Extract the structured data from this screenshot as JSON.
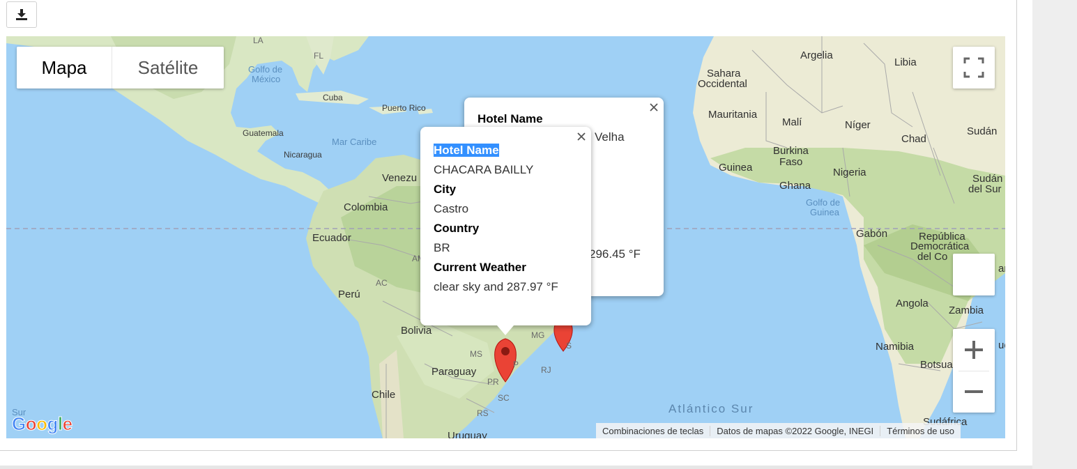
{
  "toolbar": {
    "download_icon": "download-icon"
  },
  "map_type": {
    "map_label": "Mapa",
    "satellite_label": "Satélite"
  },
  "labels": {
    "countries": {
      "argelia": "Argelia",
      "libia": "Libia",
      "sahara": "Sahara",
      "occidental": "Occidental",
      "mauritania": "Mauritania",
      "mali": "Malí",
      "niger": "Níger",
      "chad": "Chad",
      "sudan": "Sudán",
      "burkina": "Burkina",
      "faso": "Faso",
      "guinea": "Guinea",
      "nigeria": "Nigeria",
      "ghana": "Ghana",
      "sudan_sur1": "Sudán",
      "sudan_sur2": "del Sur",
      "gabon": "Gabón",
      "rep1": "República",
      "rep2": "Democrática",
      "rep3": "del Co",
      "rep_ar": "ar",
      "angola": "Angola",
      "zambia": "Zambia",
      "namibia": "Namibia",
      "botsua": "Botsua",
      "ue": "ue",
      "sudafrica": "Sudáfrica",
      "cuba": "Cuba",
      "puerto_rico": "Puerto Rico",
      "guatemala": "Guatemala",
      "nicaragua": "Nicaragua",
      "venezu": "Venezu",
      "colombia": "Colombia",
      "ecuador": "Ecuador",
      "peru": "Perú",
      "bolivia": "Bolivia",
      "paraguay": "Paraguay",
      "chile": "Chile",
      "uruguay": "Uruguay",
      "sur": "Sur"
    },
    "water": {
      "golfo_mexico1": "Golfo de",
      "golfo_mexico2": "México",
      "mar_caribe": "Mar Caribe",
      "golfo_guinea1": "Golfo de",
      "golfo_guinea2": "Guinea",
      "atlantico_sur": "Atlántico Sur"
    },
    "states": {
      "la": "LA",
      "fl": "FL",
      "am": "AM",
      "ac": "AC",
      "mg": "MG",
      "ms": "MS",
      "sp": "P",
      "pr": "PR",
      "rj": "RJ",
      "sc": "SC",
      "rs": "RS",
      "es": "S"
    }
  },
  "info_back": {
    "hotel_name_label": "Hotel Name",
    "hotel_name_partial": "Velha",
    "weather_partial": "296.45 °F"
  },
  "info_front": {
    "hotel_name_label": "Hotel Name",
    "hotel_name": "CHACARA BAILLY",
    "city_label": "City",
    "city": "Castro",
    "country_label": "Country",
    "country": "BR",
    "weather_label": "Current Weather",
    "weather": "clear sky and 287.97 °F"
  },
  "attribution": {
    "shortcuts": "Combinaciones de teclas",
    "data": "Datos de mapas ©2022 Google, INEGI",
    "terms": "Términos de uso"
  },
  "logo": {
    "text": "Google"
  },
  "colors": {
    "water": "#9fd0f5",
    "land": "#d8e8c6",
    "marker": "#ea4335",
    "highlight": "#3390ff"
  }
}
